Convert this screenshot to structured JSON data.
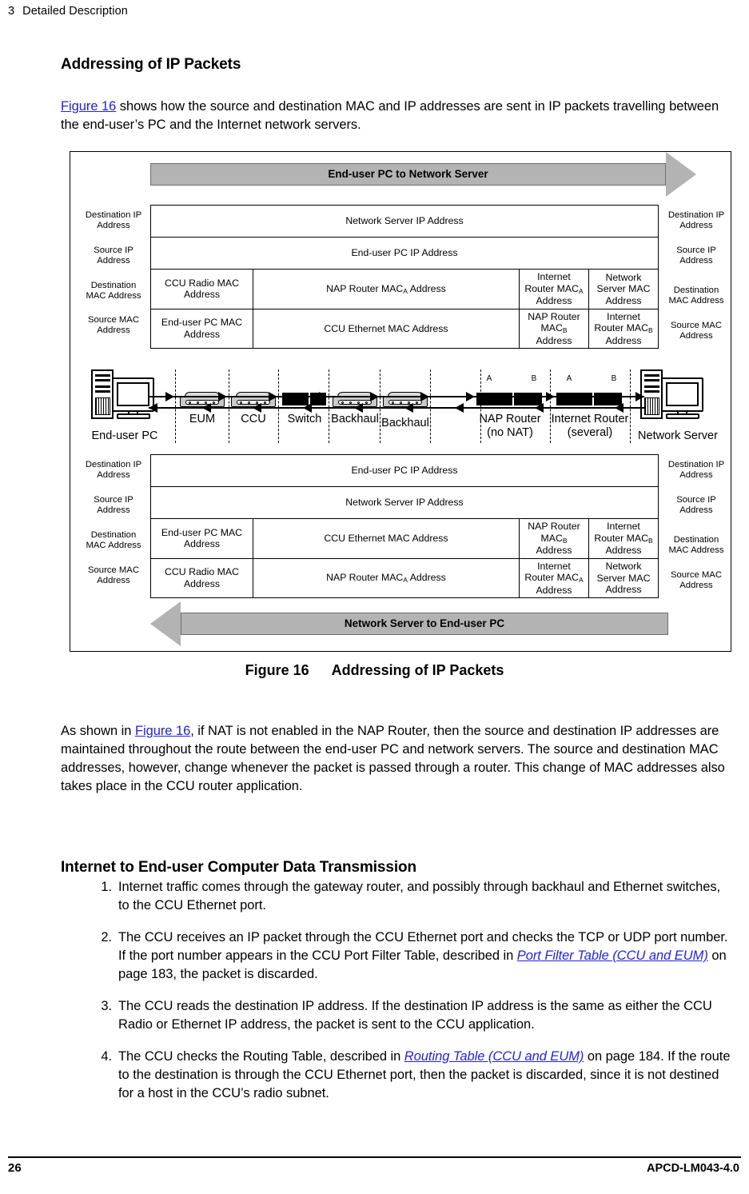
{
  "header": {
    "number": "3",
    "title": "Detailed Description"
  },
  "section": {
    "heading": "Addressing of IP Packets",
    "intro_link": "Figure 16",
    "intro_rest": " shows how the source and destination MAC and IP addresses are sent in IP packets travelling between the end-user’s PC and the Internet network servers."
  },
  "figure": {
    "caption_number": "Figure 16",
    "caption_title": "Addressing of IP Packets",
    "top_banner": "End-user PC to Network Server",
    "bottom_banner": "Network Server to End-user PC",
    "row_labels": {
      "dest_ip": "Destination IP\nAddress",
      "src_ip": "Source IP\nAddress",
      "dest_mac": "Destination\nMAC Address",
      "src_mac": "Source MAC\nAddress"
    },
    "row_labels_left_top": {
      "dest_ip_l1": "Destination IP",
      "dest_ip_l2": "Address",
      "src_ip_l1": "Source IP",
      "src_ip_l2": "Address",
      "dest_mac_l1": "Destination",
      "dest_mac_l2": "MAC Address",
      "src_mac_l1": "Source MAC",
      "src_mac_l2": "Address"
    },
    "upper_table": {
      "dest_ip": [
        {
          "text": "Network Server IP Address",
          "span": 4
        }
      ],
      "src_ip": [
        {
          "text": "End-user PC IP Address",
          "span": 4
        }
      ],
      "dest_mac": [
        {
          "text": "CCU Radio MAC Address",
          "span": 1
        },
        {
          "text": "NAP Router MAC_A Address",
          "span": 1
        },
        {
          "text": "Internet Router MAC_A Address",
          "span": 1
        },
        {
          "text": "Network Server MAC Address",
          "span": 1
        }
      ],
      "src_mac": [
        {
          "text": "End-user PC MAC Address",
          "span": 1
        },
        {
          "text": "CCU Ethernet MAC Address",
          "span": 1
        },
        {
          "text": "NAP Router MAC_B Address",
          "span": 1
        },
        {
          "text": "Internet Router MAC_B Address",
          "span": 1
        }
      ]
    },
    "lower_table": {
      "dest_ip": [
        {
          "text": "End-user PC IP Address",
          "span": 4
        }
      ],
      "src_ip": [
        {
          "text": "Network Server IP Address",
          "span": 4
        }
      ],
      "dest_mac": [
        {
          "text": "End-user PC MAC Address",
          "span": 1
        },
        {
          "text": "CCU Ethernet MAC Address",
          "span": 1
        },
        {
          "text": "NAP Router MAC_B Address",
          "span": 1
        },
        {
          "text": "Internet Router MAC_B Address",
          "span": 1
        }
      ],
      "src_mac": [
        {
          "text": "CCU Radio MAC Address",
          "span": 1
        },
        {
          "text": "NAP Router MAC_A Address",
          "span": 1
        },
        {
          "text": "Internet Router MAC_A Address",
          "span": 1
        },
        {
          "text": "Network Server MAC Address",
          "span": 1
        }
      ]
    },
    "devices": [
      {
        "name": "End-user PC",
        "type": "pc"
      },
      {
        "name": "EUM",
        "type": "radio"
      },
      {
        "name": "CCU",
        "type": "radio"
      },
      {
        "name": "Switch",
        "type": "switch"
      },
      {
        "name": "Backhaul",
        "type": "radio"
      },
      {
        "name": "Backhaul",
        "type": "radio"
      },
      {
        "name": "NAP Router",
        "sub": "(no NAT)",
        "type": "router",
        "port_a": "A",
        "port_b": "B"
      },
      {
        "name": "Internet Router",
        "sub": "(several)",
        "type": "router",
        "port_a": "A",
        "port_b": "B"
      },
      {
        "name": "Network Server",
        "type": "server"
      }
    ]
  },
  "after_figure": {
    "p1_a": "As shown in ",
    "p1_link": "Figure 16",
    "p1_b": ", if NAT is not enabled in the NAP Router, then the source and destination IP addresses are maintained throughout the route between the end-user PC and network servers. The source and destination MAC addresses, however, change whenever the packet is passed through a router. This change of MAC addresses also takes place in the CCU router application."
  },
  "section2": {
    "heading": "Internet to End-user Computer Data Transmission",
    "steps": [
      {
        "num": "1.",
        "parts": [
          {
            "t": "Internet traffic comes through the gateway router, and possibly through backhaul and Ethernet switches, to the CCU Ethernet port.",
            "s": "n"
          }
        ]
      },
      {
        "num": "2.",
        "parts": [
          {
            "t": "The CCU receives an IP packet through the CCU Ethernet port and checks the TCP or UDP port number. If the port number appears in the CCU Port Filter Table, described in ",
            "s": "n"
          },
          {
            "t": "Port Filter Table (CCU and EUM)",
            "s": "li"
          },
          {
            "t": " on page 183, the packet is discarded.",
            "s": "n"
          }
        ]
      },
      {
        "num": "3.",
        "parts": [
          {
            "t": "The CCU reads the destination IP address. If the destination IP address is the same as either the CCU Radio or Ethernet IP address, the packet is sent to the CCU application.",
            "s": "n"
          }
        ]
      },
      {
        "num": "4.",
        "parts": [
          {
            "t": "The CCU checks the Routing Table, described in ",
            "s": "n"
          },
          {
            "t": "Routing Table (CCU and EUM)",
            "s": "li"
          },
          {
            "t": " on page 184. If the route to the destination is through the CCU Ethernet port, then the packet is discarded, since it is not destined for a host in the CCU’s radio subnet.",
            "s": "n"
          }
        ]
      }
    ]
  },
  "footer": {
    "page_number": "26",
    "doc_id": "APCD-LM043-4.0"
  },
  "colors": {
    "link": "#2222dd",
    "banner_fill": "#b3b3b3",
    "banner_stroke": "#6e6e6e"
  }
}
